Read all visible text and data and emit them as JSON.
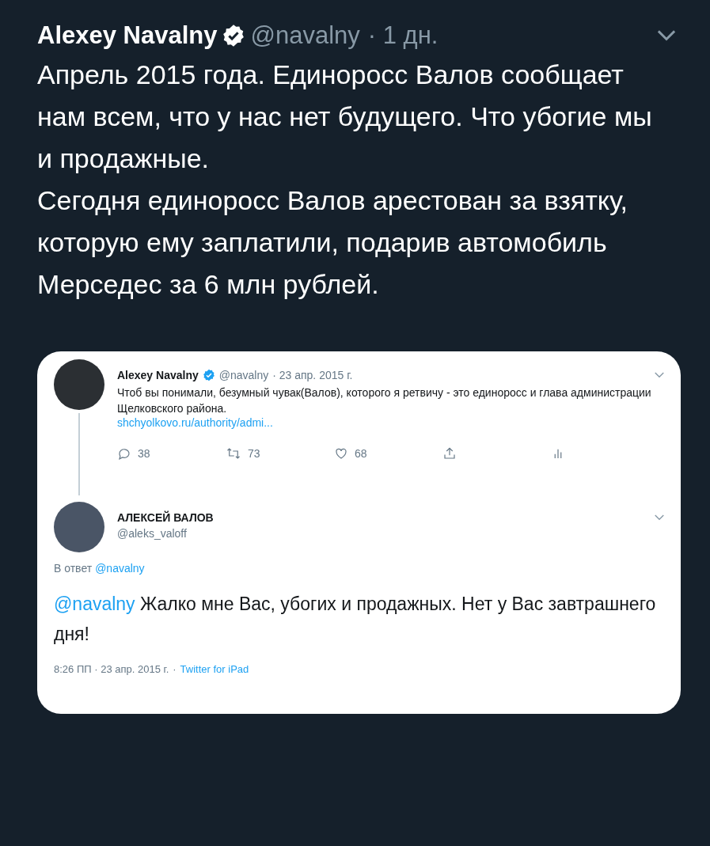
{
  "tweet": {
    "name": "Alexey Navalny",
    "verified": true,
    "handle": "@navalny",
    "time": "· 1 дн.",
    "paragraphs": [
      "Апрель 2015 года. Единоросс Валов сообщает нам всем, что у нас нет будущего. Что убогие мы и продажные.",
      "Сегодня единоросс Валов арестован за взятку, которую ему заплатили, подарив автомобиль Мерседес за 6 млн рублей."
    ]
  },
  "screenshot": {
    "original": {
      "name": "Alexey Navalny",
      "verified": true,
      "handle": "@navalny",
      "time": "· 23 апр. 2015 г.",
      "text": "Чтоб вы понимали, безумный чувак(Валов), которого я ретвичу - это единоросс и глава администрации Щелковского района.",
      "link": "shchyolkovo.ru/authority/admi...",
      "actions": [
        {
          "kind": "reply",
          "count": "38"
        },
        {
          "kind": "retweet",
          "count": "73"
        },
        {
          "kind": "like",
          "count": "68"
        },
        {
          "kind": "share"
        },
        {
          "kind": "analytics"
        }
      ]
    },
    "reply": {
      "name": "АЛЕКСЕЙ ВАЛОВ",
      "handle": "@aleks_valoff",
      "reply_to_label": "В ответ",
      "reply_to": "@navalny",
      "mention": "@navalny",
      "text": "Жалко мне Вас, убогих и продажных. Нет у Вас завтрашнего дня!",
      "time": "8:26 ПП · 23 апр. 2015 г.",
      "separator": "·",
      "source": "Twitter for iPad"
    }
  }
}
